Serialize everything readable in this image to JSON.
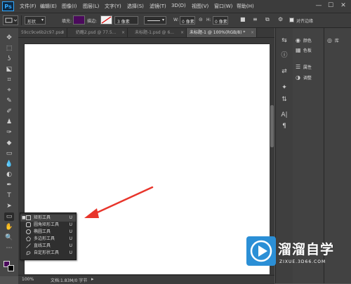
{
  "app": {
    "logo": "Ps"
  },
  "menu": [
    "文件(F)",
    "编辑(E)",
    "图像(I)",
    "图层(L)",
    "文字(Y)",
    "选择(S)",
    "滤镜(T)",
    "3D(D)",
    "视图(V)",
    "窗口(W)",
    "帮助(H)"
  ],
  "window_controls": {
    "minimize": "—",
    "maximize": "☐",
    "close": "✕"
  },
  "options": {
    "mode_value": "形状",
    "fill_label": "填充:",
    "fill_color": "#4b0a5c",
    "stroke_label": "描边:",
    "stroke_width_value": "3 像素",
    "w_label": "W:",
    "w_value": "0 像素",
    "link_icon": "⊝",
    "h_label": "H:",
    "h_value": "0 像素",
    "align_edges_label": "对齐边缘"
  },
  "tabs": [
    {
      "label": "59cc9ce6b2c97.psd",
      "active": false
    },
    {
      "label": "奶酪2.psd @ 77.5...",
      "active": false
    },
    {
      "label": "未标题-1.psd @ 6...",
      "active": false
    },
    {
      "label": "未标题-1 @ 100%(RGB/8) *",
      "active": true
    }
  ],
  "tab_close": "×",
  "tools": [
    "✥",
    "⬚",
    "ʖ",
    "⬕",
    "⌗",
    "⌖",
    "✎",
    "✐",
    "♟",
    "✑",
    "◆",
    "▭",
    "💧",
    "◐",
    "✒",
    "T",
    "➤",
    "▭",
    "✋",
    "🔍",
    "⋯"
  ],
  "flyout": [
    {
      "label": "矩形工具",
      "key": "U",
      "selected": true,
      "shape": "rect"
    },
    {
      "label": "圆角矩形工具",
      "key": "U",
      "selected": false,
      "shape": "round"
    },
    {
      "label": "椭圆工具",
      "key": "U",
      "selected": false,
      "shape": "ellipse"
    },
    {
      "label": "多边形工具",
      "key": "U",
      "selected": false,
      "shape": "poly"
    },
    {
      "label": "直线工具",
      "key": "U",
      "selected": false,
      "shape": "line"
    },
    {
      "label": "自定形状工具",
      "key": "U",
      "selected": false,
      "shape": "custom"
    }
  ],
  "status": {
    "zoom": "100%",
    "doc_info": "文档:1.83M/0 字节"
  },
  "icon_strip": [
    "⇆",
    "ⓘ",
    "⇄",
    "✦",
    "⇅",
    "A|",
    "¶"
  ],
  "panels": [
    {
      "icon": "◉",
      "label": "颜色"
    },
    {
      "icon": "▦",
      "label": "色板"
    },
    {
      "icon": "☰",
      "label": "属性"
    },
    {
      "icon": "◑",
      "label": "调整"
    }
  ],
  "panel2": {
    "icon": "◎",
    "label": "库"
  },
  "colors": {
    "foreground": "#4b0a5c",
    "background": "#000000",
    "arrow": "#e8352b",
    "watermark": "#2b8fd6"
  },
  "watermark": {
    "title": "溜溜自学",
    "url": "ZIXUE.3D66.COM"
  }
}
